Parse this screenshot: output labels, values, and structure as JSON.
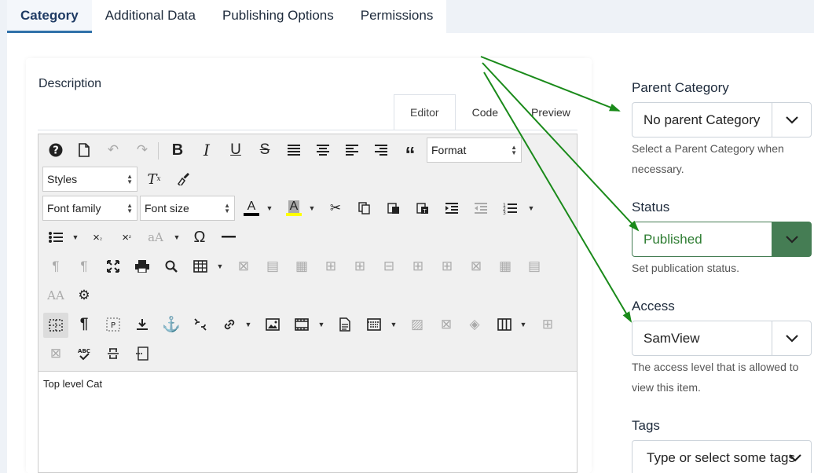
{
  "tabs": [
    "Category",
    "Additional Data",
    "Publishing Options",
    "Permissions"
  ],
  "description_label": "Description",
  "editor_tabs": [
    "Editor",
    "Code",
    "Preview"
  ],
  "toolbar": {
    "format": "Format",
    "styles": "Styles",
    "font_family": "Font family",
    "font_size": "Font size"
  },
  "editor_content": "Top level Cat",
  "parent_category": {
    "label": "Parent Category",
    "value": "No parent Category",
    "help": "Select a Parent Category when necessary."
  },
  "status": {
    "label": "Status",
    "value": "Published",
    "help": "Set publication status.",
    "color": "#457d54"
  },
  "access": {
    "label": "Access",
    "value": "SamView",
    "help": "The access level that is allowed to view this item."
  },
  "tags": {
    "label": "Tags",
    "placeholder": "Type or select some tags"
  },
  "colors": {
    "accent": "#3071a9",
    "arrow": "#1a8a1a"
  }
}
